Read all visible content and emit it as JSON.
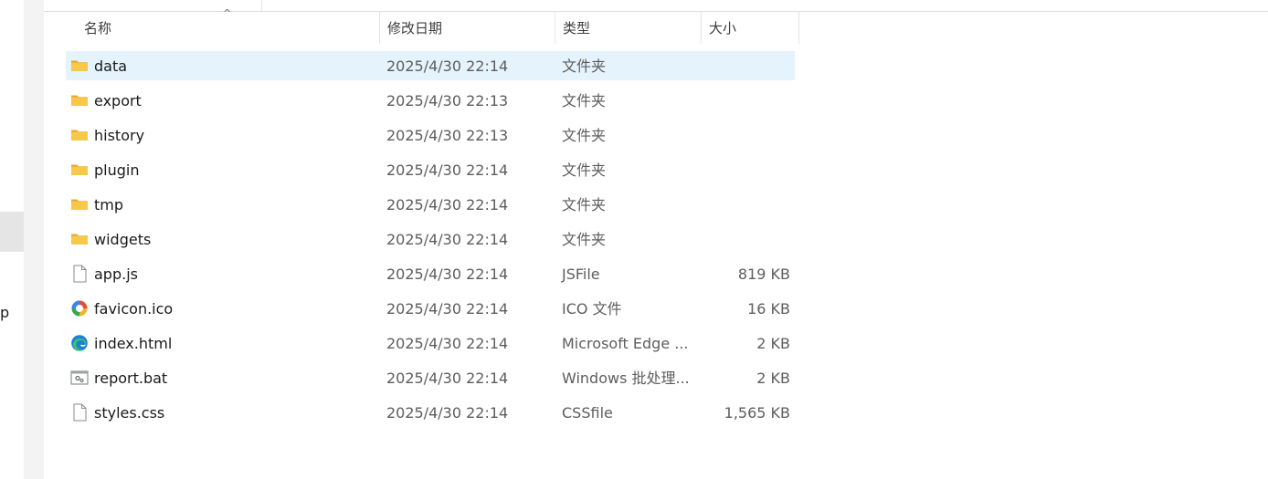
{
  "columns": {
    "name": "名称",
    "date": "修改日期",
    "type": "类型",
    "size": "大小"
  },
  "sort_indicator": "^",
  "left_pane_text": "p",
  "files": [
    {
      "name": "data",
      "date": "2025/4/30 22:14",
      "type": "文件夹",
      "size": "",
      "icon": "folder-icon",
      "selected": true
    },
    {
      "name": "export",
      "date": "2025/4/30 22:13",
      "type": "文件夹",
      "size": "",
      "icon": "folder-icon"
    },
    {
      "name": "history",
      "date": "2025/4/30 22:13",
      "type": "文件夹",
      "size": "",
      "icon": "folder-icon"
    },
    {
      "name": "plugin",
      "date": "2025/4/30 22:14",
      "type": "文件夹",
      "size": "",
      "icon": "folder-icon"
    },
    {
      "name": "tmp",
      "date": "2025/4/30 22:14",
      "type": "文件夹",
      "size": "",
      "icon": "folder-icon"
    },
    {
      "name": "widgets",
      "date": "2025/4/30 22:14",
      "type": "文件夹",
      "size": "",
      "icon": "folder-icon"
    },
    {
      "name": "app.js",
      "date": "2025/4/30 22:14",
      "type": "JSFile",
      "size": "819 KB",
      "icon": "file-icon"
    },
    {
      "name": "favicon.ico",
      "date": "2025/4/30 22:14",
      "type": "ICO 文件",
      "size": "16 KB",
      "icon": "ico-file-icon"
    },
    {
      "name": "index.html",
      "date": "2025/4/30 22:14",
      "type": "Microsoft Edge ...",
      "size": "2 KB",
      "icon": "edge-html-icon"
    },
    {
      "name": "report.bat",
      "date": "2025/4/30 22:14",
      "type": "Windows 批处理...",
      "size": "2 KB",
      "icon": "batch-file-icon"
    },
    {
      "name": "styles.css",
      "date": "2025/4/30 22:14",
      "type": "CSSfile",
      "size": "1,565 KB",
      "icon": "file-icon"
    }
  ],
  "colors": {
    "selection": "#e5f3fc",
    "folder": "#f8c84a",
    "text_secondary": "#5d5d5d"
  }
}
